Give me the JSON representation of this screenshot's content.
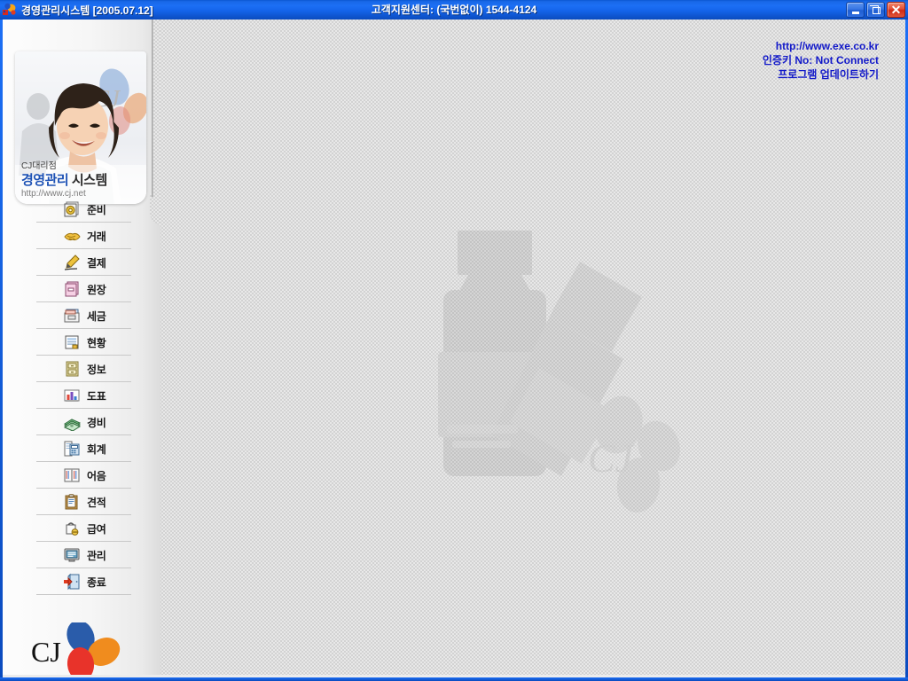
{
  "window": {
    "title": "경영관리시스템 [2005.07.12]",
    "center_title": "고객지원센터: (국번없이) 1544-4124",
    "app_icon": "app-icon",
    "buttons": {
      "minimize": "minimize-button",
      "restore": "restore-button",
      "close": "close-button",
      "close_glyph": "✕"
    }
  },
  "links": [
    {
      "label": "http://www.exe.co.kr",
      "name": "exe-homepage-link"
    },
    {
      "label": "인증키 No: Not Connect",
      "name": "auth-key-status-link"
    },
    {
      "label": "프로그램 업데이트하기",
      "name": "program-update-link"
    }
  ],
  "banner": {
    "sub": "CJ대리점",
    "title_primary": "경영관리",
    "title_secondary": " 시스템",
    "url": "http://www.cj.net"
  },
  "menu": [
    {
      "label": "준비",
      "icon": "prepare-icon"
    },
    {
      "label": "거래",
      "icon": "handshake-icon"
    },
    {
      "label": "결제",
      "icon": "pen-signature-icon"
    },
    {
      "label": "원장",
      "icon": "ledger-books-icon"
    },
    {
      "label": "세금",
      "icon": "tax-filebox-icon"
    },
    {
      "label": "현황",
      "icon": "status-report-icon"
    },
    {
      "label": "정보",
      "icon": "info-cabinet-icon"
    },
    {
      "label": "도표",
      "icon": "bar-chart-icon"
    },
    {
      "label": "경비",
      "icon": "money-stack-icon"
    },
    {
      "label": "회계",
      "icon": "accounting-calculator-icon"
    },
    {
      "label": "어음",
      "icon": "open-book-icon"
    },
    {
      "label": "견적",
      "icon": "clipboard-quote-icon"
    },
    {
      "label": "급여",
      "icon": "payroll-icon"
    },
    {
      "label": "관리",
      "icon": "monitor-manage-icon"
    },
    {
      "label": "종료",
      "icon": "exit-door-icon"
    }
  ],
  "logo": {
    "wordmark": "CJ",
    "colors": {
      "blue": "#2a5caa",
      "orange": "#f08c1e",
      "red": "#e8332a"
    }
  },
  "watermark": {
    "text": "CJ",
    "description": "bottles-watermark"
  },
  "colors": {
    "titlebar_blue": "#1c6ff5",
    "link_blue": "#1219c9",
    "banner_blue": "#1d52b5",
    "surface": "#e8e8e8"
  }
}
